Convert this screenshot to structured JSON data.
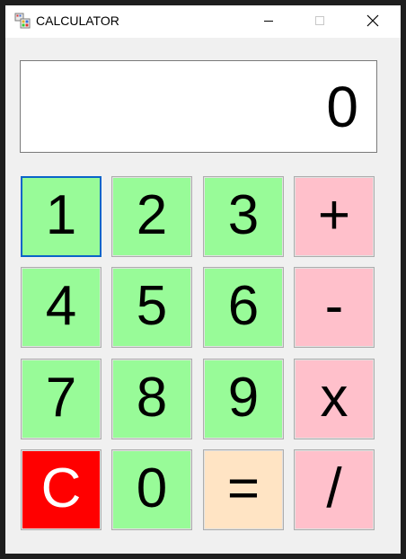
{
  "window": {
    "title": "CALCULATOR",
    "icon": "app-icon",
    "controls": {
      "minimize": "minimize-icon",
      "maximize": "maximize-icon",
      "close": "close-icon"
    }
  },
  "display": {
    "value": "0"
  },
  "keys": {
    "k1": "1",
    "k2": "2",
    "k3": "3",
    "plus": "+",
    "k4": "4",
    "k5": "5",
    "k6": "6",
    "minus": "-",
    "k7": "7",
    "k8": "8",
    "k9": "9",
    "multiply": "x",
    "clear": "C",
    "k0": "0",
    "equals": "=",
    "divide": "/"
  },
  "colors": {
    "number_key": "#98fb98",
    "operator_key": "#ffc0cb",
    "clear_key": "#ff0000",
    "equals_key": "#ffe4c4",
    "focus_border": "#0a64c9"
  }
}
